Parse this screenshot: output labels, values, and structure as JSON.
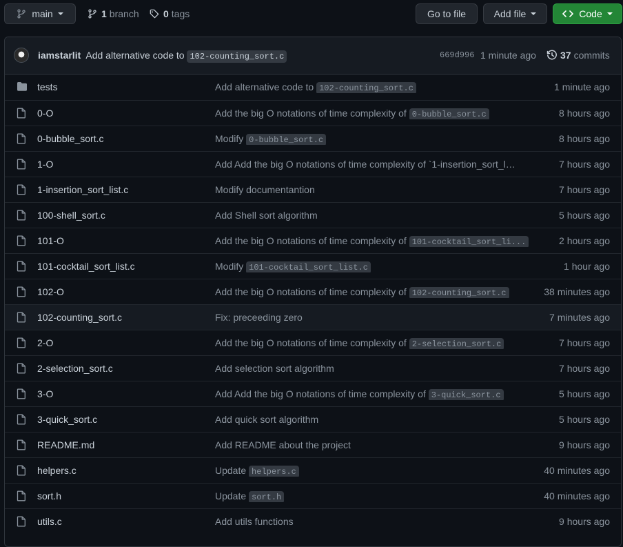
{
  "toolbar": {
    "branch_name": "main",
    "branches_count": "1",
    "branches_label": "branch",
    "tags_count": "0",
    "tags_label": "tags",
    "goto_file": "Go to file",
    "add_file": "Add file",
    "code": "Code"
  },
  "latest_commit": {
    "author": "iamstarlit",
    "message_prefix": "Add alternative code to",
    "message_code": "102-counting_sort.c",
    "sha": "669d996",
    "time": "1 minute ago",
    "commits_count": "37",
    "commits_label": "commits"
  },
  "colors": {
    "background": "#0d1117",
    "header_bg": "#161b22",
    "border": "#30363d",
    "text": "#c9d1d9",
    "muted": "#8b949e",
    "code_button": "#238636"
  },
  "files": [
    {
      "type": "folder",
      "name": "tests",
      "msg": "Add alternative code to",
      "code": "102-counting_sort.c",
      "time": "1 minute ago"
    },
    {
      "type": "file",
      "name": "0-O",
      "msg": "Add the big O notations of time complexity of",
      "code": "0-bubble_sort.c",
      "time": "8 hours ago"
    },
    {
      "type": "file",
      "name": "0-bubble_sort.c",
      "msg": "Modify",
      "code": "0-bubble_sort.c",
      "time": "8 hours ago"
    },
    {
      "type": "file",
      "name": "1-O",
      "msg": "Add Add the big O notations of time complexity of `1-insertion_sort_l…",
      "code": "",
      "time": "7 hours ago"
    },
    {
      "type": "file",
      "name": "1-insertion_sort_list.c",
      "msg": "Modify documentantion",
      "code": "",
      "time": "7 hours ago"
    },
    {
      "type": "file",
      "name": "100-shell_sort.c",
      "msg": "Add Shell sort algorithm",
      "code": "",
      "time": "5 hours ago"
    },
    {
      "type": "file",
      "name": "101-O",
      "msg": "Add the big O notations of time complexity of",
      "code": "101-cocktail_sort_li...",
      "time": "2 hours ago"
    },
    {
      "type": "file",
      "name": "101-cocktail_sort_list.c",
      "msg": "Modify",
      "code": "101-cocktail_sort_list.c",
      "time": "1 hour ago"
    },
    {
      "type": "file",
      "name": "102-O",
      "msg": "Add the big O notations of time complexity of",
      "code": "102-counting_sort.c",
      "time": "38 minutes ago"
    },
    {
      "type": "file",
      "name": "102-counting_sort.c",
      "msg": "Fix: preceeding zero",
      "code": "",
      "time": "7 minutes ago"
    },
    {
      "type": "file",
      "name": "2-O",
      "msg": "Add the big O notations of time complexity of",
      "code": "2-selection_sort.c",
      "time": "7 hours ago"
    },
    {
      "type": "file",
      "name": "2-selection_sort.c",
      "msg": "Add selection sort algorithm",
      "code": "",
      "time": "7 hours ago"
    },
    {
      "type": "file",
      "name": "3-O",
      "msg": "Add Add the big O notations of time complexity of",
      "code": "3-quick_sort.c",
      "time": "5 hours ago"
    },
    {
      "type": "file",
      "name": "3-quick_sort.c",
      "msg": "Add quick sort algorithm",
      "code": "",
      "time": "5 hours ago"
    },
    {
      "type": "file",
      "name": "README.md",
      "msg": "Add README about the project",
      "code": "",
      "time": "9 hours ago"
    },
    {
      "type": "file",
      "name": "helpers.c",
      "msg": "Update",
      "code": "helpers.c",
      "time": "40 minutes ago"
    },
    {
      "type": "file",
      "name": "sort.h",
      "msg": "Update",
      "code": "sort.h",
      "time": "40 minutes ago"
    },
    {
      "type": "file",
      "name": "utils.c",
      "msg": "Add utils functions",
      "code": "",
      "time": "9 hours ago"
    }
  ]
}
